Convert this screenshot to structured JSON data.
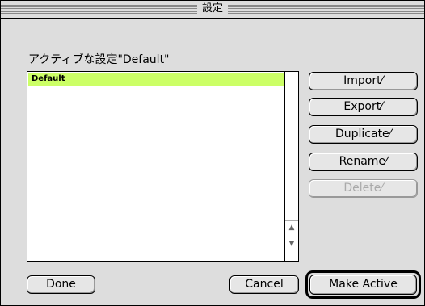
{
  "window": {
    "title": "設定"
  },
  "active_label": "アクティブな設定\"Default\"",
  "list": {
    "items": [
      {
        "label": "Default",
        "selected": true
      }
    ]
  },
  "buttons": {
    "import": "Import⁄",
    "export": "Export⁄",
    "duplicate": "Duplicate⁄",
    "rename": "Rename⁄",
    "delete": "Delete⁄",
    "done": "Done",
    "cancel": "Cancel",
    "make_active": "Make Active"
  },
  "colors": {
    "selection": "#ccff66",
    "window_bg": "#dddddd"
  },
  "icons": {
    "scroll_up": "up-arrow-icon",
    "scroll_down": "down-arrow-icon"
  }
}
